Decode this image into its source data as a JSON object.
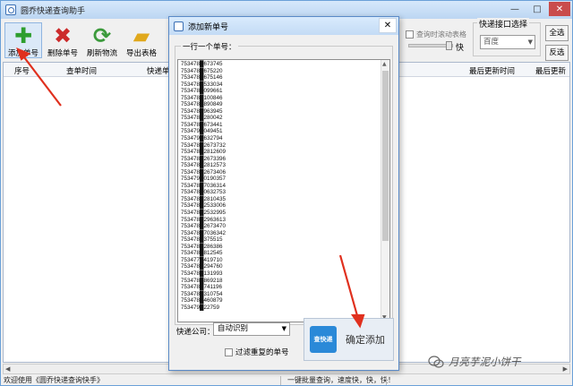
{
  "main_window": {
    "title": "圆乔快递查询助手",
    "controls": {
      "minimize": "—",
      "maximize": "□",
      "close": "✕"
    }
  },
  "toolbar": {
    "buttons": [
      {
        "label": "添加单号",
        "icon": "plus-icon",
        "color": "#2e9e2e"
      },
      {
        "label": "删除单号",
        "icon": "delete-x-icon",
        "color": "#cc2b2b"
      },
      {
        "label": "刷新物流",
        "icon": "refresh-icon",
        "color": "#3c9a3c"
      },
      {
        "label": "导出表格",
        "icon": "export-folder-icon",
        "color": "#e0a81c"
      }
    ]
  },
  "options": {
    "auto_scroll_label": "查询时滚动表格",
    "speed_label": "快",
    "port_group_label": "快递接口选择",
    "port_value": "百度",
    "select_all": "全选",
    "invert": "反选"
  },
  "grid": {
    "columns": [
      "序号",
      "查单时间",
      "快递单号",
      "最后更新时间",
      "最后更新"
    ]
  },
  "status": {
    "left": "欢迎使用《圆乔快递查询快手》",
    "middle": "一键批量查询，速度快，快，快！"
  },
  "dialog": {
    "title": "添加新单号",
    "close": "✕",
    "instruction": "一行一个单号：",
    "tracking_numbers": [
      "753478█673745",
      "753478█675220",
      "753478█675146",
      "753478█533034",
      "753478█099661",
      "753478█100846",
      "753478█890849",
      "753478█963945",
      "753478█280042",
      "753478█673441",
      "753479█049451",
      "753479█632794",
      "753478█2673732",
      "753478█2812609",
      "753478█2673396",
      "753478█2812573",
      "753478█2673406",
      "753479█0190357",
      "753478█7036314",
      "753478█0632753",
      "753478█2810435",
      "753478█2533006",
      "753478█2532995",
      "753478█2963613",
      "753478█2673470",
      "753478█7036342",
      "753478█375515",
      "753478█286386",
      "753478█812545",
      "753477█419710",
      "753478█294760",
      "753478█131993",
      "753478█869218",
      "753478█741196",
      "753478█310754",
      "753478█460879",
      "753479█22759"
    ],
    "courier_label": "快递公司：",
    "courier_value": "自动识别",
    "filter_label": "过滤重复的单号",
    "confirm_logo": "查快递",
    "confirm_label": "确定添加"
  },
  "watermark": {
    "text": "月亮芋泥小饼干"
  }
}
